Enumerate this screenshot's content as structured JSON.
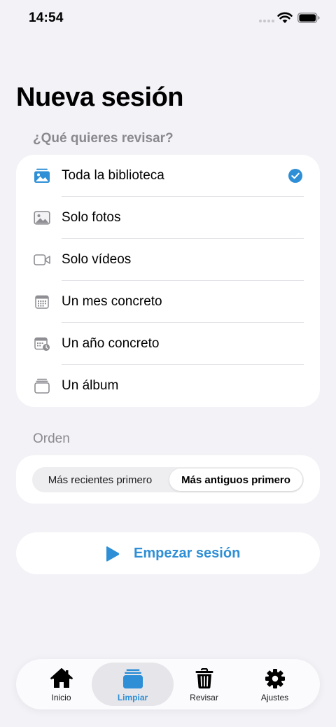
{
  "status_bar": {
    "time": "14:54"
  },
  "title": "Nueva sesión",
  "scope_section": {
    "label": "¿Qué quieres revisar?",
    "options": [
      {
        "label": "Toda la biblioteca",
        "icon": "photo-library-icon",
        "selected": true
      },
      {
        "label": "Solo fotos",
        "icon": "photo-icon",
        "selected": false
      },
      {
        "label": "Solo vídeos",
        "icon": "video-icon",
        "selected": false
      },
      {
        "label": "Un mes concreto",
        "icon": "calendar-icon",
        "selected": false
      },
      {
        "label": "Un año concreto",
        "icon": "calendar-clock-icon",
        "selected": false
      },
      {
        "label": "Un álbum",
        "icon": "album-stack-icon",
        "selected": false
      }
    ]
  },
  "order_section": {
    "label": "Orden",
    "options": [
      "Más recientes primero",
      "Más antiguos primero"
    ],
    "selected": "Más antiguos primero"
  },
  "start_button": {
    "label": "Empezar sesión"
  },
  "tab_bar": {
    "tabs": [
      {
        "label": "Inicio",
        "icon": "house-icon",
        "active": false
      },
      {
        "label": "Limpiar",
        "icon": "stack-icon",
        "active": true
      },
      {
        "label": "Revisar",
        "icon": "trash-icon",
        "active": false
      },
      {
        "label": "Ajustes",
        "icon": "gear-icon",
        "active": false
      }
    ]
  },
  "colors": {
    "accent": "#2e8fd6",
    "background": "#f2f2f7",
    "secondary_text": "#8a8a8e"
  }
}
